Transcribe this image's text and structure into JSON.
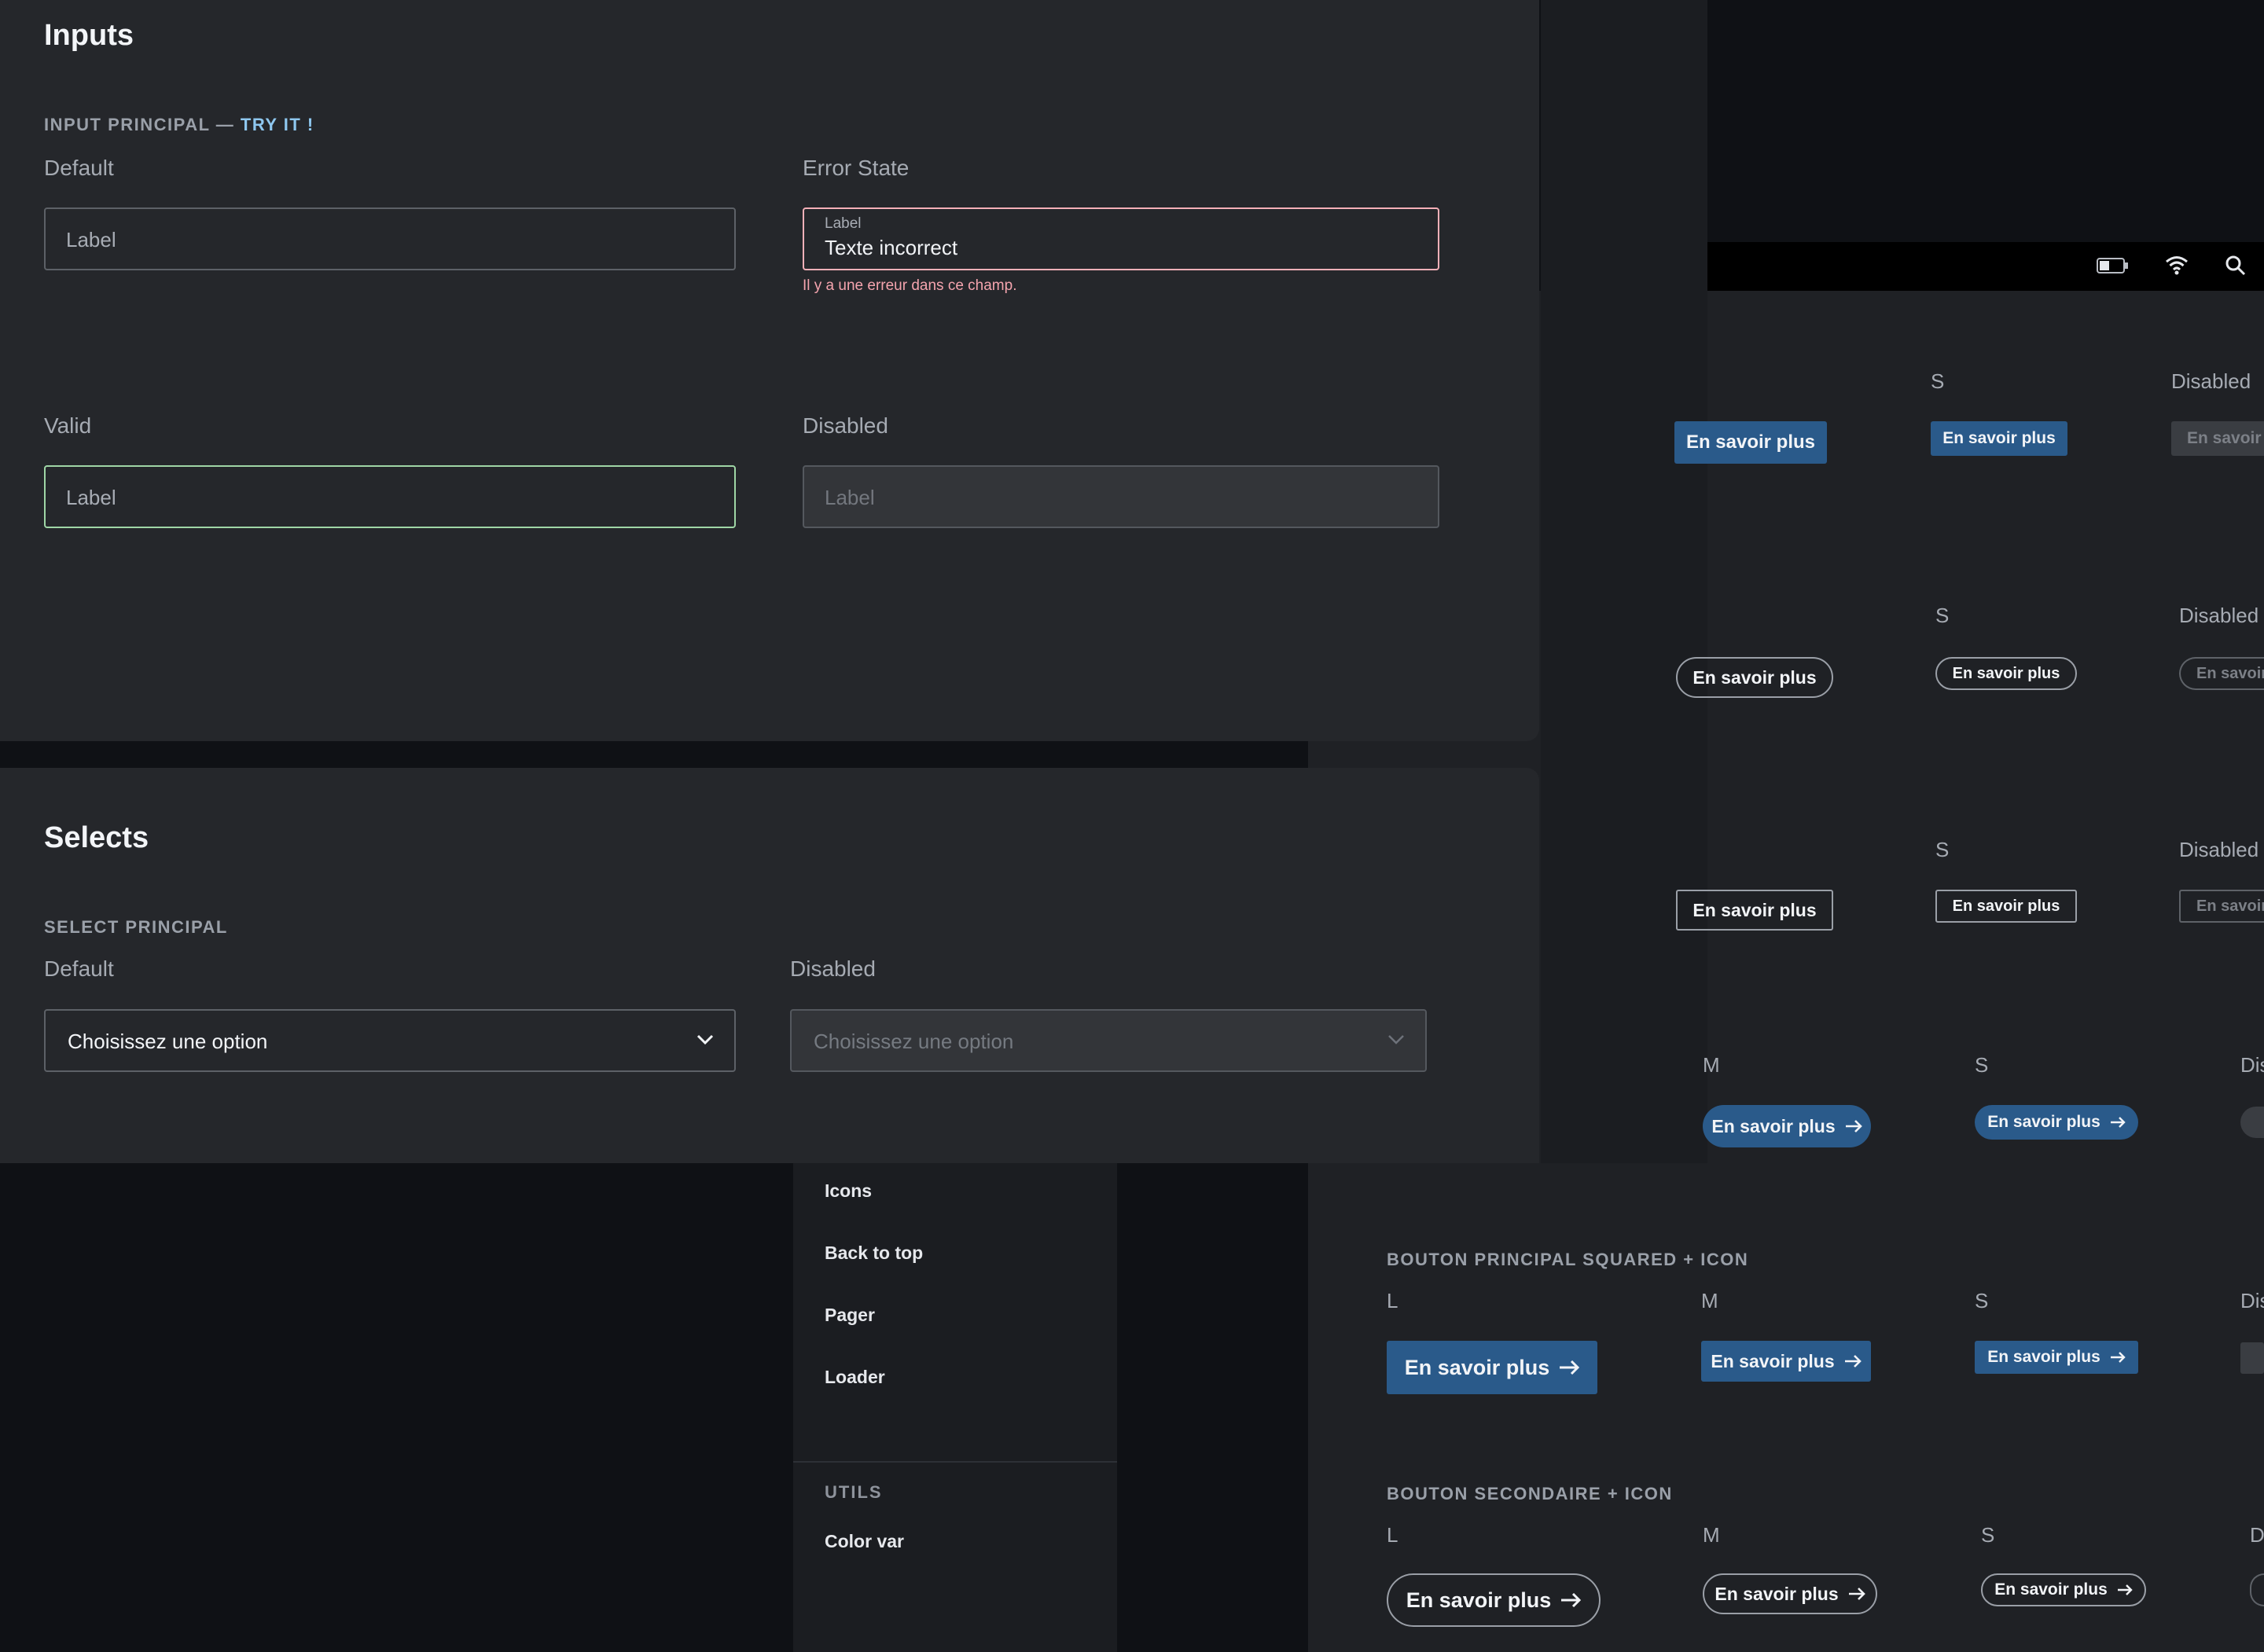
{
  "inputs": {
    "title": "Inputs",
    "section_label": "INPUT PRINCIPAL — ",
    "section_accent": "TRY IT !",
    "default": {
      "title": "Default",
      "placeholder": "Label"
    },
    "error": {
      "title": "Error State",
      "label": "Label",
      "value": "Texte incorrect",
      "message": "Il y a une erreur dans ce champ."
    },
    "valid": {
      "title": "Valid",
      "placeholder": "Label"
    },
    "disabled": {
      "title": "Disabled",
      "placeholder": "Label"
    }
  },
  "selects": {
    "title": "Selects",
    "section_label": "SELECT PRINCIPAL",
    "default": {
      "title": "Default",
      "value": "Choisissez une option"
    },
    "disabled": {
      "title": "Disabled",
      "value": "Choisissez une option"
    }
  },
  "nav": {
    "items": [
      "Icons",
      "Back to top",
      "Pager",
      "Loader"
    ],
    "group_utils": "UTILS",
    "utils_items": [
      "Color var"
    ]
  },
  "buttons": {
    "label_btn": "En savoir plus",
    "size_l": "L",
    "size_m": "M",
    "size_s": "S",
    "disabled": "Disabled",
    "disabled_short": "Dis",
    "disabled_min": "D",
    "group_squared_icon": "BOUTON PRINCIPAL SQUARED + ICON",
    "group_secondary_icon": "BOUTON SECONDAIRE + ICON"
  },
  "status_icons": [
    "battery-icon",
    "wifi-icon",
    "search-icon"
  ],
  "colors": {
    "primary": "#2a5a8a",
    "error": "#f4b0b8",
    "valid": "#9fd6a6",
    "accent": "#8ec7ef"
  }
}
